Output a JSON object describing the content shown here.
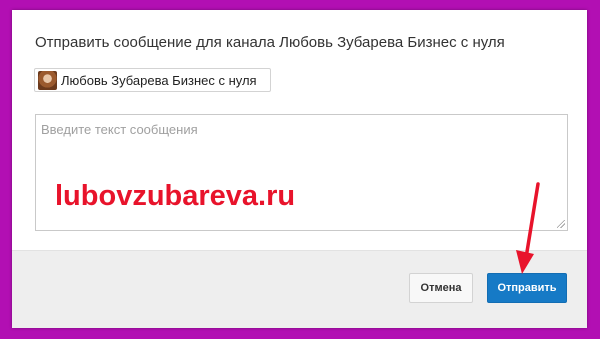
{
  "dialog": {
    "title": "Отправить сообщение для канала Любовь Зубарева Бизнес с нуля",
    "channel": {
      "name": "Любовь Зубарева Бизнес с нуля",
      "avatar_icon": "user-photo-avatar"
    },
    "message": {
      "placeholder": "Введите текст сообщения",
      "value": ""
    },
    "watermark": "lubovzubareva.ru",
    "buttons": {
      "cancel_label": "Отмена",
      "send_label": "Отправить"
    }
  },
  "colors": {
    "frame": "#b20fb3",
    "accent": "#167ac6",
    "watermark": "#e8132b",
    "arrow": "#e8132b"
  }
}
